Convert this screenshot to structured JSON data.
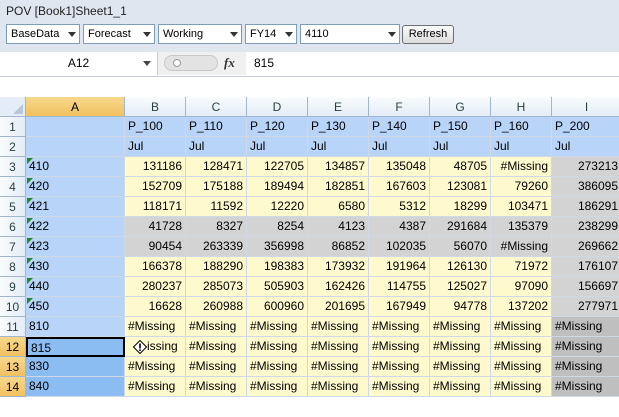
{
  "pov": {
    "title": "POV [Book1]Sheet1_1",
    "dropdowns": [
      "BaseData",
      "Forecast",
      "Working",
      "FY14",
      "4110"
    ],
    "refresh_label": "Refresh"
  },
  "formula_bar": {
    "name_box": "A12",
    "fx_label": "fx",
    "value": "815"
  },
  "sheet": {
    "columns": [
      "A",
      "B",
      "C",
      "D",
      "E",
      "F",
      "G",
      "H",
      "I"
    ],
    "row_numbers": [
      "1",
      "2",
      "3",
      "4",
      "5",
      "6",
      "7",
      "8",
      "9",
      "10",
      "11",
      "12",
      "13",
      "14"
    ],
    "rows": [
      [
        "",
        "P_100",
        "P_110",
        "P_120",
        "P_130",
        "P_140",
        "P_150",
        "P_160",
        "P_200"
      ],
      [
        "",
        "Jul",
        "Jul",
        "Jul",
        "Jul",
        "Jul",
        "Jul",
        "Jul",
        "Jul"
      ],
      [
        "410",
        "131186",
        "128471",
        "122705",
        "134857",
        "135048",
        "48705",
        "#Missing",
        "273213"
      ],
      [
        "420",
        "152709",
        "175188",
        "189494",
        "182851",
        "167603",
        "123081",
        "79260",
        "386095"
      ],
      [
        "421",
        "118171",
        "11592",
        "12220",
        "6580",
        "5312",
        "18299",
        "103471",
        "186291"
      ],
      [
        "422",
        "41728",
        "8327",
        "8254",
        "4123",
        "4387",
        "291684",
        "135379",
        "238299"
      ],
      [
        "423",
        "90454",
        "263339",
        "356998",
        "86852",
        "102035",
        "56070",
        "#Missing",
        "269662"
      ],
      [
        "430",
        "166378",
        "188290",
        "198383",
        "173932",
        "191964",
        "126130",
        "71972",
        "176107"
      ],
      [
        "440",
        "280237",
        "285073",
        "505903",
        "162426",
        "114755",
        "125027",
        "97090",
        "156697"
      ],
      [
        "450",
        "16628",
        "260988",
        "600960",
        "201695",
        "167949",
        "94778",
        "137202",
        "277971"
      ],
      [
        "810",
        "#Missing",
        "#Missing",
        "#Missing",
        "#Missing",
        "#Missing",
        "#Missing",
        "#Missing",
        "#Missing"
      ],
      [
        "815",
        "issing",
        "#Missing",
        "#Missing",
        "#Missing",
        "#Missing",
        "#Missing",
        "#Missing",
        "#Missing"
      ],
      [
        "830",
        "#Missing",
        "#Missing",
        "#Missing",
        "#Missing",
        "#Missing",
        "#Missing",
        "#Missing",
        "#Missing"
      ],
      [
        "840",
        "#Missing",
        "#Missing",
        "#Missing",
        "#Missing",
        "#Missing",
        "#Missing",
        "#Missing",
        "#Missing"
      ]
    ],
    "selected_cell": "A12",
    "selected_rows": [
      "12",
      "13",
      "14"
    ],
    "selected_column": "A"
  },
  "colors": {
    "header_blue": "#b8d4f8",
    "selection_blue": "#8cbdf2",
    "data_yellow": "#fffacd",
    "readonly_gray": "#d3d3d3",
    "selection_header_orange": "#f1c15f"
  },
  "icons": {
    "warning": "warning-diamond-icon",
    "function": "fx-icon"
  }
}
